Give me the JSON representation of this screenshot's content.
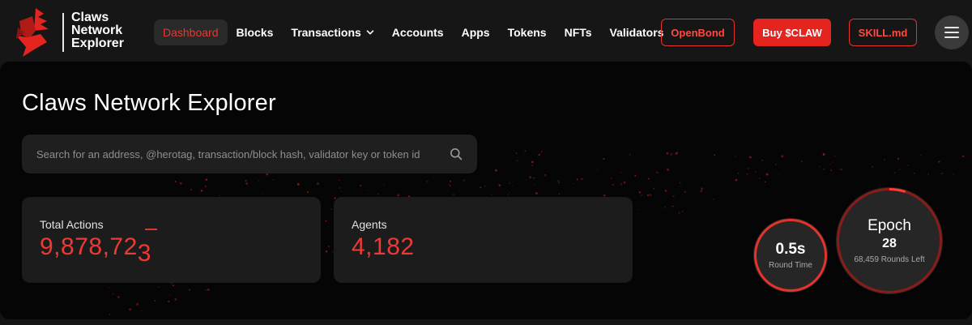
{
  "brand": {
    "name_line1": "Claws",
    "name_line2": "Network",
    "name_line3": "Explorer",
    "accent_color": "#e3241f"
  },
  "nav": {
    "items": [
      {
        "label": "Dashboard",
        "active": true
      },
      {
        "label": "Blocks"
      },
      {
        "label": "Transactions",
        "has_dropdown": true
      },
      {
        "label": "Accounts"
      },
      {
        "label": "Apps"
      },
      {
        "label": "Tokens"
      },
      {
        "label": "NFTs"
      },
      {
        "label": "Validators"
      }
    ],
    "chevron_icon": "chevron-down-icon"
  },
  "header_buttons": {
    "openbond": "OpenBond",
    "buy": "Buy $CLAW",
    "skill": "SKILL.md",
    "menu_icon": "hamburger-menu-icon"
  },
  "hero": {
    "title": "Claws Network Explorer",
    "search_placeholder": "Search for an address, @herotag, transaction/block hash, validator key or token id",
    "search_icon": "search-icon"
  },
  "stats": {
    "total_actions_label": "Total Actions",
    "total_actions_value": "9,878,72",
    "total_actions_last_digit": "3",
    "agents_label": "Agents",
    "agents_value": "4,182"
  },
  "round": {
    "value": "0.5s",
    "label": "Round Time"
  },
  "epoch": {
    "title": "Epoch",
    "number": "28",
    "rounds_left": "68,459 Rounds Left",
    "progress": 0.05
  }
}
